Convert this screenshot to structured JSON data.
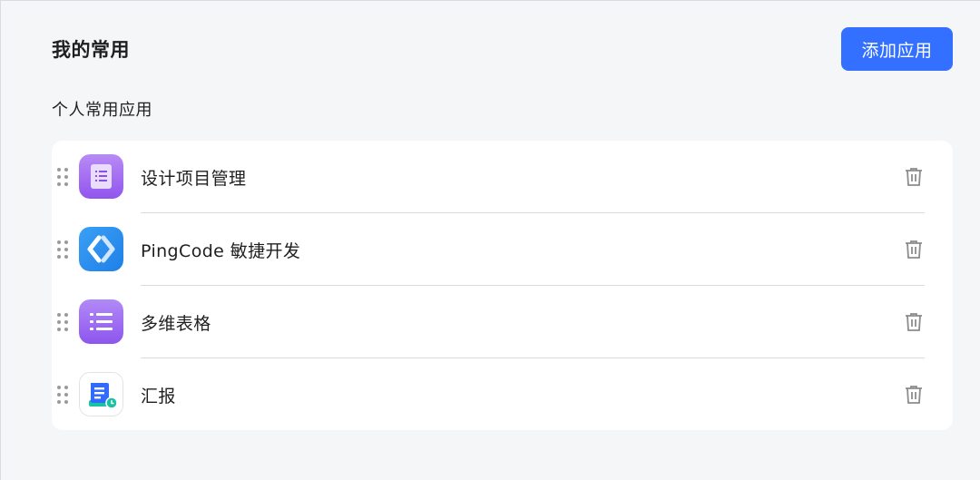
{
  "header": {
    "title": "我的常用",
    "add_button_label": "添加应用"
  },
  "section": {
    "title": "个人常用应用"
  },
  "apps": [
    {
      "name": "设计项目管理",
      "icon": "project-management-icon",
      "color": "#a06cf0"
    },
    {
      "name": "PingCode 敏捷开发",
      "icon": "pingcode-icon",
      "color": "#2a8cf0"
    },
    {
      "name": "多维表格",
      "icon": "multi-dimensional-table-icon",
      "color": "#9a5ef0"
    },
    {
      "name": "汇报",
      "icon": "report-icon",
      "color": "#2f6bff"
    }
  ],
  "colors": {
    "accent": "#3370ff",
    "background": "#f5f6f8",
    "card": "#ffffff"
  }
}
